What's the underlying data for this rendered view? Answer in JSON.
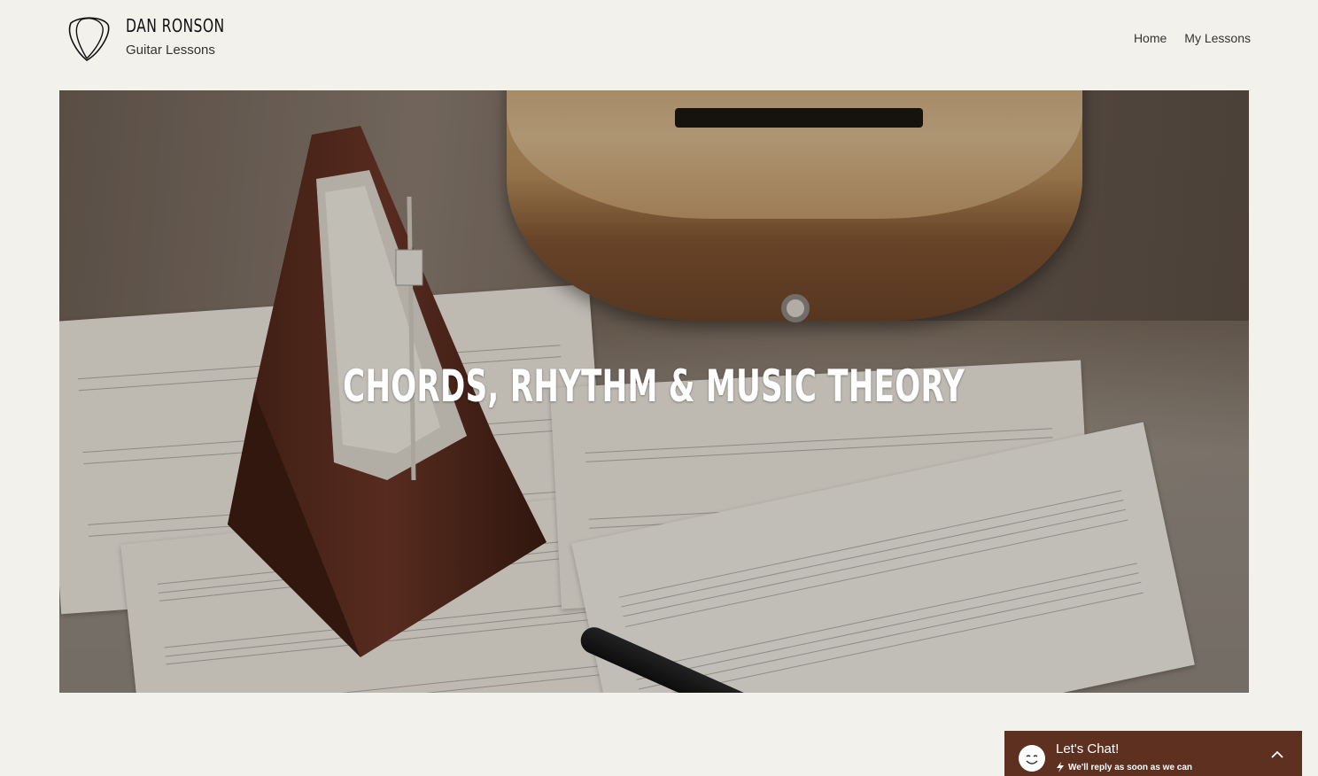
{
  "brand": {
    "name": "DAN RONSON",
    "tagline": "Guitar Lessons",
    "logo_icon": "guitar-pick-icon"
  },
  "nav": {
    "items": [
      {
        "label": "Home"
      },
      {
        "label": "My Lessons"
      }
    ]
  },
  "hero": {
    "title": "CHORDS, RHYTHM & MUSIC THEORY"
  },
  "chat": {
    "title": "Let's Chat!",
    "subtitle": "We'll reply as soon as we can",
    "bg_color": "#5d3020"
  },
  "colors": {
    "page_bg": "#f2f1ec",
    "text": "#1f1f1f"
  }
}
